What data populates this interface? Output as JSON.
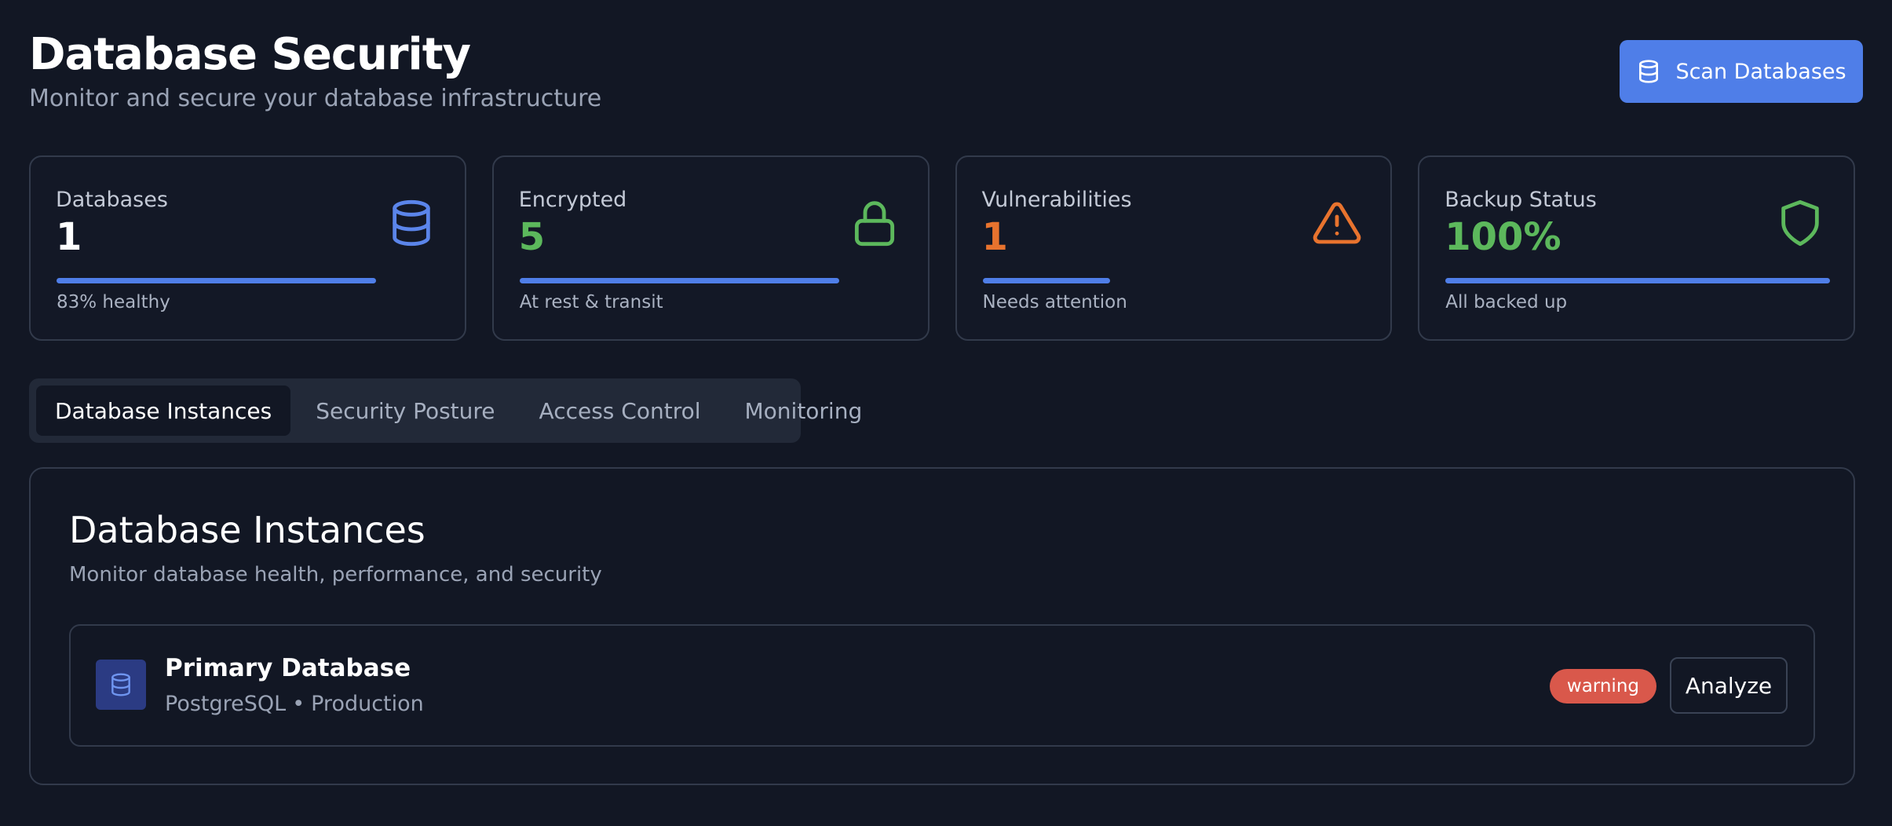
{
  "header": {
    "title": "Database Security",
    "subtitle": "Monitor and secure your database infrastructure",
    "scan_button_label": "Scan Databases",
    "scan_button_icon": "database-icon"
  },
  "stats": [
    {
      "label": "Databases",
      "value": "1",
      "note": "83% healthy",
      "progress": 0.83,
      "value_color": "#ffffff",
      "icon": "database-icon",
      "icon_color": "#5b85ea"
    },
    {
      "label": "Encrypted",
      "value": "5",
      "note": "At rest & transit",
      "progress": 0.83,
      "value_color": "#5cb85c",
      "icon": "lock-icon",
      "icon_color": "#5cb85c"
    },
    {
      "label": "Vulnerabilities",
      "value": "1",
      "note": "Needs attention",
      "progress": 0.33,
      "value_color": "#e8732e",
      "icon": "warning-icon",
      "icon_color": "#e8732e"
    },
    {
      "label": "Backup Status",
      "value": "100%",
      "note": "All backed up",
      "progress": 1.0,
      "value_color": "#5cb85c",
      "icon": "shield-icon",
      "icon_color": "#5cb85c"
    }
  ],
  "tabs": [
    {
      "label": "Database Instances",
      "active": true
    },
    {
      "label": "Security Posture",
      "active": false
    },
    {
      "label": "Access Control",
      "active": false
    },
    {
      "label": "Monitoring",
      "active": false
    }
  ],
  "panel": {
    "title": "Database Instances",
    "subtitle": "Monitor database health, performance, and security",
    "instances": [
      {
        "name": "Primary Database",
        "engine": "PostgreSQL",
        "separator": "•",
        "environment": "Production",
        "status": "warning",
        "status_color": "#d9584b",
        "action_label": "Analyze",
        "icon": "database-icon"
      }
    ]
  },
  "colors": {
    "background": "#121724",
    "accent": "#4f7ee8",
    "border": "#323a4b",
    "success": "#5cb85c",
    "warning": "#e8732e",
    "danger": "#d9584b"
  }
}
